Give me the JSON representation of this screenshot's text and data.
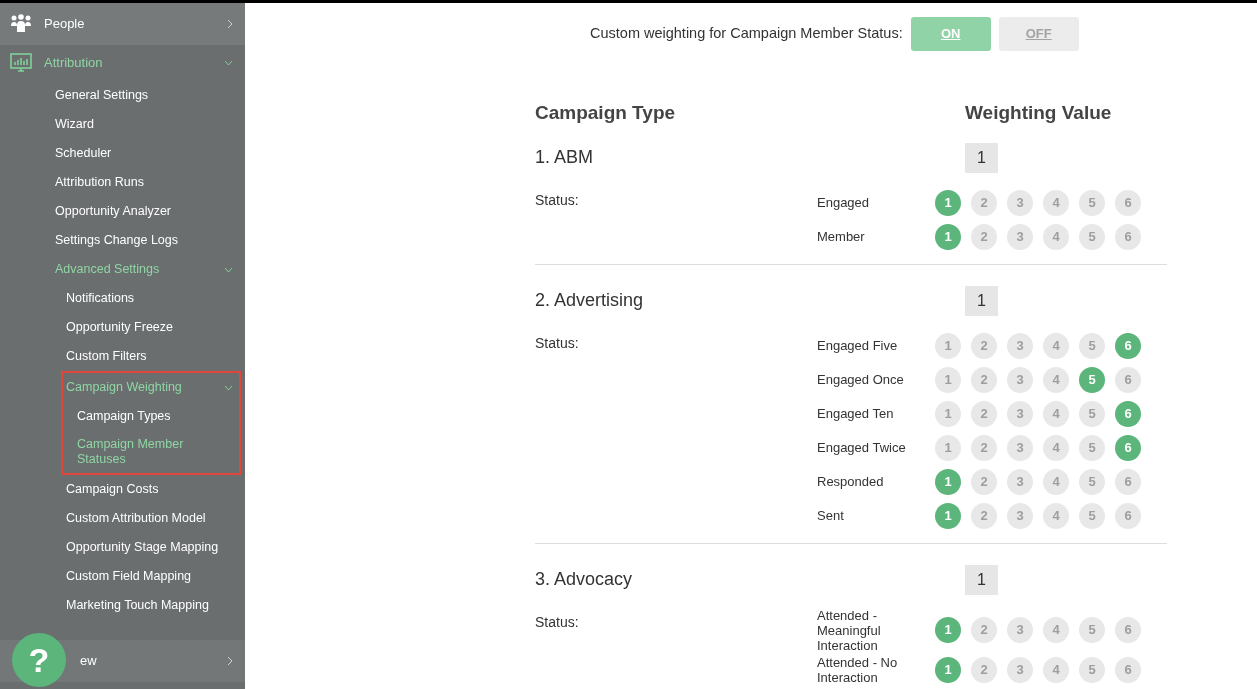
{
  "sidebar": {
    "items": [
      {
        "label": "People",
        "expanded": false,
        "selected": false
      },
      {
        "label": "Attribution",
        "expanded": true,
        "selected": true,
        "children": [
          {
            "label": "General Settings",
            "selected": false
          },
          {
            "label": "Wizard",
            "selected": false
          },
          {
            "label": "Scheduler",
            "selected": false
          },
          {
            "label": "Attribution Runs",
            "selected": false
          },
          {
            "label": "Opportunity Analyzer",
            "selected": false
          },
          {
            "label": "Settings Change Logs",
            "selected": false
          },
          {
            "label": "Advanced Settings",
            "selected": true,
            "expanded": true,
            "children": [
              {
                "label": "Notifications",
                "selected": false
              },
              {
                "label": "Opportunity Freeze",
                "selected": false
              },
              {
                "label": "Custom Filters",
                "selected": false
              },
              {
                "label": "Campaign Weighting",
                "selected": true,
                "expanded": true,
                "highlighted": true,
                "children": [
                  {
                    "label": "Campaign Types",
                    "selected": false
                  },
                  {
                    "label": "Campaign Member Statuses",
                    "selected": true
                  }
                ]
              },
              {
                "label": "Campaign Costs",
                "selected": false
              },
              {
                "label": "Custom Attribution Model",
                "selected": false
              },
              {
                "label": "Opportunity Stage Mapping",
                "selected": false
              },
              {
                "label": "Custom Field Mapping",
                "selected": false
              },
              {
                "label": "Marketing Touch Mapping",
                "selected": false
              }
            ]
          }
        ]
      },
      {
        "label": "ew",
        "expanded": false,
        "selected": false
      }
    ]
  },
  "help_button": {
    "label": "?"
  },
  "toggle": {
    "label": "Custom weighting for Campaign Member Status:",
    "options": [
      {
        "label": "ON",
        "selected": true
      },
      {
        "label": "OFF",
        "selected": false
      }
    ]
  },
  "columns": [
    "Campaign Type",
    "Weighting Value"
  ],
  "campaign_types": [
    {
      "name": "1. ABM",
      "weight": "1",
      "status_label": "Status:",
      "statuses": [
        {
          "name": "Engaged",
          "options": [
            {
              "label": "1",
              "selected": true
            },
            {
              "label": "2",
              "selected": false
            },
            {
              "label": "3",
              "selected": false
            },
            {
              "label": "4",
              "selected": false
            },
            {
              "label": "5",
              "selected": false
            },
            {
              "label": "6",
              "selected": false
            }
          ]
        },
        {
          "name": "Member",
          "options": [
            {
              "label": "1",
              "selected": true
            },
            {
              "label": "2",
              "selected": false
            },
            {
              "label": "3",
              "selected": false
            },
            {
              "label": "4",
              "selected": false
            },
            {
              "label": "5",
              "selected": false
            },
            {
              "label": "6",
              "selected": false
            }
          ]
        }
      ]
    },
    {
      "name": "2. Advertising",
      "weight": "1",
      "status_label": "Status:",
      "statuses": [
        {
          "name": "Engaged Five",
          "options": [
            {
              "label": "1",
              "selected": false
            },
            {
              "label": "2",
              "selected": false
            },
            {
              "label": "3",
              "selected": false
            },
            {
              "label": "4",
              "selected": false
            },
            {
              "label": "5",
              "selected": false
            },
            {
              "label": "6",
              "selected": true
            }
          ]
        },
        {
          "name": "Engaged Once",
          "options": [
            {
              "label": "1",
              "selected": false
            },
            {
              "label": "2",
              "selected": false
            },
            {
              "label": "3",
              "selected": false
            },
            {
              "label": "4",
              "selected": false
            },
            {
              "label": "5",
              "selected": true
            },
            {
              "label": "6",
              "selected": false
            }
          ]
        },
        {
          "name": "Engaged Ten",
          "options": [
            {
              "label": "1",
              "selected": false
            },
            {
              "label": "2",
              "selected": false
            },
            {
              "label": "3",
              "selected": false
            },
            {
              "label": "4",
              "selected": false
            },
            {
              "label": "5",
              "selected": false
            },
            {
              "label": "6",
              "selected": true
            }
          ]
        },
        {
          "name": "Engaged Twice",
          "options": [
            {
              "label": "1",
              "selected": false
            },
            {
              "label": "2",
              "selected": false
            },
            {
              "label": "3",
              "selected": false
            },
            {
              "label": "4",
              "selected": false
            },
            {
              "label": "5",
              "selected": false
            },
            {
              "label": "6",
              "selected": true
            }
          ]
        },
        {
          "name": "Responded",
          "options": [
            {
              "label": "1",
              "selected": true
            },
            {
              "label": "2",
              "selected": false
            },
            {
              "label": "3",
              "selected": false
            },
            {
              "label": "4",
              "selected": false
            },
            {
              "label": "5",
              "selected": false
            },
            {
              "label": "6",
              "selected": false
            }
          ]
        },
        {
          "name": "Sent",
          "options": [
            {
              "label": "1",
              "selected": true
            },
            {
              "label": "2",
              "selected": false
            },
            {
              "label": "3",
              "selected": false
            },
            {
              "label": "4",
              "selected": false
            },
            {
              "label": "5",
              "selected": false
            },
            {
              "label": "6",
              "selected": false
            }
          ]
        }
      ]
    },
    {
      "name": "3. Advocacy",
      "weight": "1",
      "status_label": "Status:",
      "statuses": [
        {
          "name": "Attended - Meaningful Interaction",
          "options": [
            {
              "label": "1",
              "selected": true
            },
            {
              "label": "2",
              "selected": false
            },
            {
              "label": "3",
              "selected": false
            },
            {
              "label": "4",
              "selected": false
            },
            {
              "label": "5",
              "selected": false
            },
            {
              "label": "6",
              "selected": false
            }
          ]
        },
        {
          "name": "Attended - No Interaction",
          "options": [
            {
              "label": "1",
              "selected": true
            },
            {
              "label": "2",
              "selected": false
            },
            {
              "label": "3",
              "selected": false
            },
            {
              "label": "4",
              "selected": false
            },
            {
              "label": "5",
              "selected": false
            },
            {
              "label": "6",
              "selected": false
            }
          ]
        }
      ]
    }
  ]
}
